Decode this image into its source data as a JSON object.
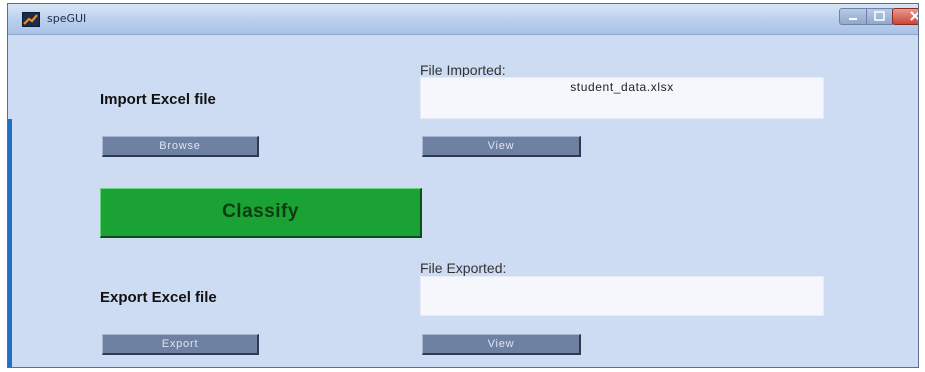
{
  "window": {
    "title": "speGUI"
  },
  "import": {
    "label": "Import Excel file",
    "caption": "File Imported:",
    "value": "student_data.xlsx",
    "browse_label": "Browse",
    "view_label": "View"
  },
  "classify": {
    "label": "Classify"
  },
  "export": {
    "label": "Export Excel file",
    "caption": "File Exported:",
    "value": "",
    "export_label": "Export",
    "view_label": "View"
  },
  "colors": {
    "window_bg": "#cddcf3",
    "classify_green": "#1aa234",
    "button_slate": "#6f81a3"
  },
  "icons": [
    "matlab-app-icon",
    "minimize-icon",
    "maximize-icon",
    "close-icon"
  ]
}
